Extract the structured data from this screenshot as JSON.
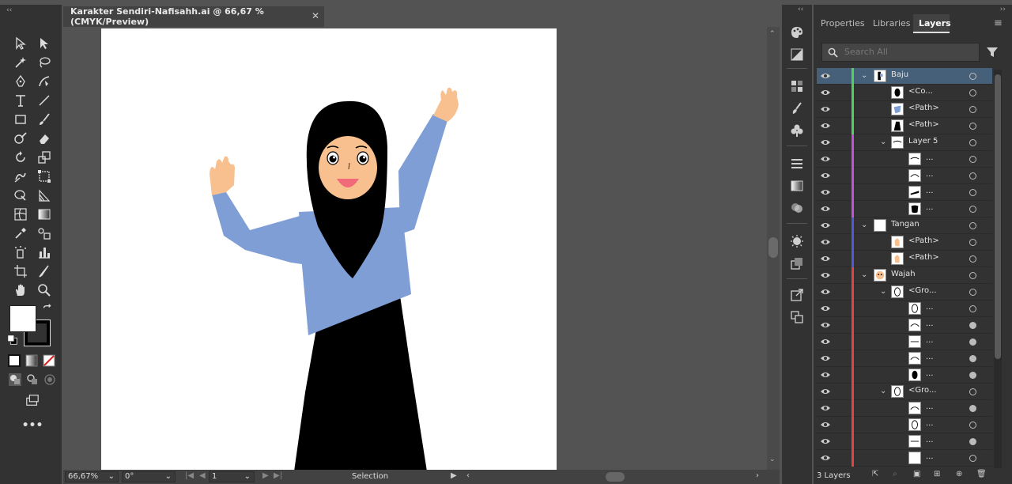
{
  "document": {
    "tab_title": "Karakter Sendiri-Nafisahh.ai @ 66,67 % (CMYK/Preview)",
    "close_glyph": "✕"
  },
  "statusbar": {
    "zoom": "66,67%",
    "rotation": "0°",
    "artboard_number": "1",
    "tool_name": "Selection"
  },
  "panel": {
    "tabs": [
      "Properties",
      "Libraries",
      "Layers"
    ],
    "active_tab": "Layers",
    "search_placeholder": "Search All",
    "footer_label": "3 Layers"
  },
  "layers": [
    {
      "name": "Baju",
      "depth": 0,
      "expanded": true,
      "selected": true,
      "color": "#4fd35a",
      "thumb": "figure",
      "target": "open"
    },
    {
      "name": "<Co...",
      "depth": 2,
      "color": "#4fd35a",
      "thumb": "hijab",
      "target": "open"
    },
    {
      "name": "<Path>",
      "depth": 2,
      "color": "#4fd35a",
      "thumb": "shirt",
      "target": "open"
    },
    {
      "name": "<Path>",
      "depth": 2,
      "color": "#4fd35a",
      "thumb": "skirt",
      "target": "open"
    },
    {
      "name": "Layer 5",
      "depth": 1,
      "expanded": true,
      "color": "#c153d8",
      "thumb": "lines",
      "target": "open"
    },
    {
      "name": "...",
      "depth": 3,
      "color": "#c153d8",
      "thumb": "lines",
      "target": "open"
    },
    {
      "name": "...",
      "depth": 3,
      "color": "#c153d8",
      "thumb": "curve",
      "target": "open"
    },
    {
      "name": "...",
      "depth": 3,
      "color": "#c153d8",
      "thumb": "brow",
      "target": "open"
    },
    {
      "name": "...",
      "depth": 3,
      "color": "#c153d8",
      "thumb": "blob",
      "target": "open"
    },
    {
      "name": "Tangan",
      "depth": 0,
      "expanded": true,
      "color": "#4e5bd6",
      "thumb": "blank",
      "target": "open"
    },
    {
      "name": "<Path>",
      "depth": 2,
      "color": "#4e5bd6",
      "thumb": "hand",
      "target": "open"
    },
    {
      "name": "<Path>",
      "depth": 2,
      "color": "#4e5bd6",
      "thumb": "hand",
      "target": "open"
    },
    {
      "name": "Wajah",
      "depth": 0,
      "expanded": true,
      "color": "#e04545",
      "thumb": "face",
      "target": "open"
    },
    {
      "name": "<Gro...",
      "depth": 1,
      "expanded": true,
      "color": "#e04545",
      "thumb": "oval",
      "target": "open"
    },
    {
      "name": "...",
      "depth": 3,
      "color": "#e04545",
      "thumb": "oval",
      "target": "open"
    },
    {
      "name": "...",
      "depth": 3,
      "color": "#e04545",
      "thumb": "curve",
      "target": "filled"
    },
    {
      "name": "...",
      "depth": 3,
      "color": "#e04545",
      "thumb": "line",
      "target": "filled"
    },
    {
      "name": "...",
      "depth": 3,
      "color": "#e04545",
      "thumb": "curve",
      "target": "filled"
    },
    {
      "name": "...",
      "depth": 3,
      "color": "#e04545",
      "thumb": "blackoval",
      "target": "filled"
    },
    {
      "name": "<Gro...",
      "depth": 1,
      "expanded": true,
      "color": "#e04545",
      "thumb": "oval",
      "target": "open"
    },
    {
      "name": "...",
      "depth": 3,
      "color": "#e04545",
      "thumb": "curve",
      "target": "filled"
    },
    {
      "name": "...",
      "depth": 3,
      "color": "#e04545",
      "thumb": "oval",
      "target": "open"
    },
    {
      "name": "...",
      "depth": 3,
      "color": "#e04545",
      "thumb": "line",
      "target": "filled"
    },
    {
      "name": "...",
      "depth": 3,
      "color": "#e04545",
      "thumb": "blank",
      "target": "open"
    }
  ],
  "colors": {
    "skin": "#f7c08e",
    "shirt": "#7f9ed6",
    "hijab": "#000000",
    "mouth": "#f06a7a"
  }
}
